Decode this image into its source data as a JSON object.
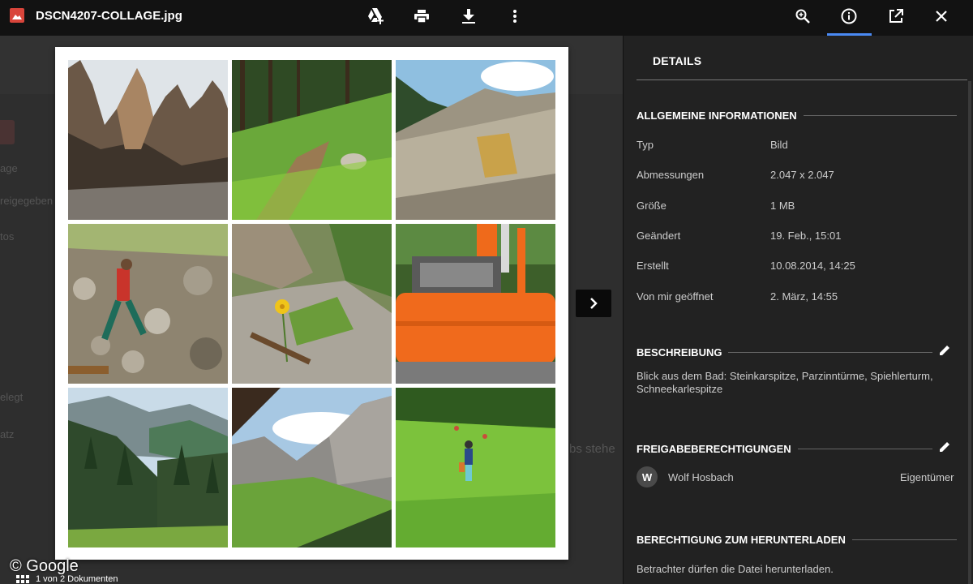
{
  "window": {
    "title": "DSCN4207-COLLAGE.jpg",
    "file_icon": "image-file-icon"
  },
  "toolbar": {
    "center_icons": [
      "add-to-drive-icon",
      "print-icon",
      "download-icon",
      "more-vert-icon"
    ],
    "right_icons": [
      "zoom-icon",
      "info-icon",
      "open-in-new-icon",
      "close-icon"
    ],
    "active": "info-icon",
    "accent_color": "#4a8af4"
  },
  "background": {
    "ghost_items": [
      "age",
      "reigegeben",
      "tos",
      "elegt",
      "atz",
      "bs stehe"
    ]
  },
  "viewer": {
    "watermark": "© Google",
    "pager_label": "1 von 2 Dokumenten",
    "next_icon": "chevron-right-icon",
    "tiles": [
      "dolomite-peaks",
      "forest-path",
      "quarry-slope",
      "hiker-on-rocks",
      "yellow-flower-valley",
      "orange-excavator",
      "alpine-valley",
      "mountain-from-hut",
      "children-on-meadow"
    ]
  },
  "details": {
    "title": "DETAILS",
    "general": {
      "heading": "ALLGEMEINE INFORMATIONEN",
      "rows": [
        {
          "label": "Typ",
          "value": "Bild"
        },
        {
          "label": "Abmessungen",
          "value": "2.047 x 2.047"
        },
        {
          "label": "Größe",
          "value": "1 MB"
        },
        {
          "label": "Geändert",
          "value": "19. Feb., 15:01"
        },
        {
          "label": "Erstellt",
          "value": "10.08.2014, 14:25"
        },
        {
          "label": "Von mir geöffnet",
          "value": "2. März, 14:55"
        }
      ]
    },
    "description": {
      "heading": "BESCHREIBUNG",
      "text": "Blick aus dem Bad: Steinkarspitze, Parzinntürme, Spiehlerturm, Schneekarlespitze"
    },
    "sharing": {
      "heading": "FREIGABEBERECHTIGUNGEN",
      "avatar_letter": "W",
      "owner_name": "Wolf Hosbach",
      "owner_role": "Eigentümer"
    },
    "download": {
      "heading": "BERECHTIGUNG ZUM HERUNTERLADEN",
      "text": "Betrachter dürfen die Datei herunterladen."
    }
  }
}
